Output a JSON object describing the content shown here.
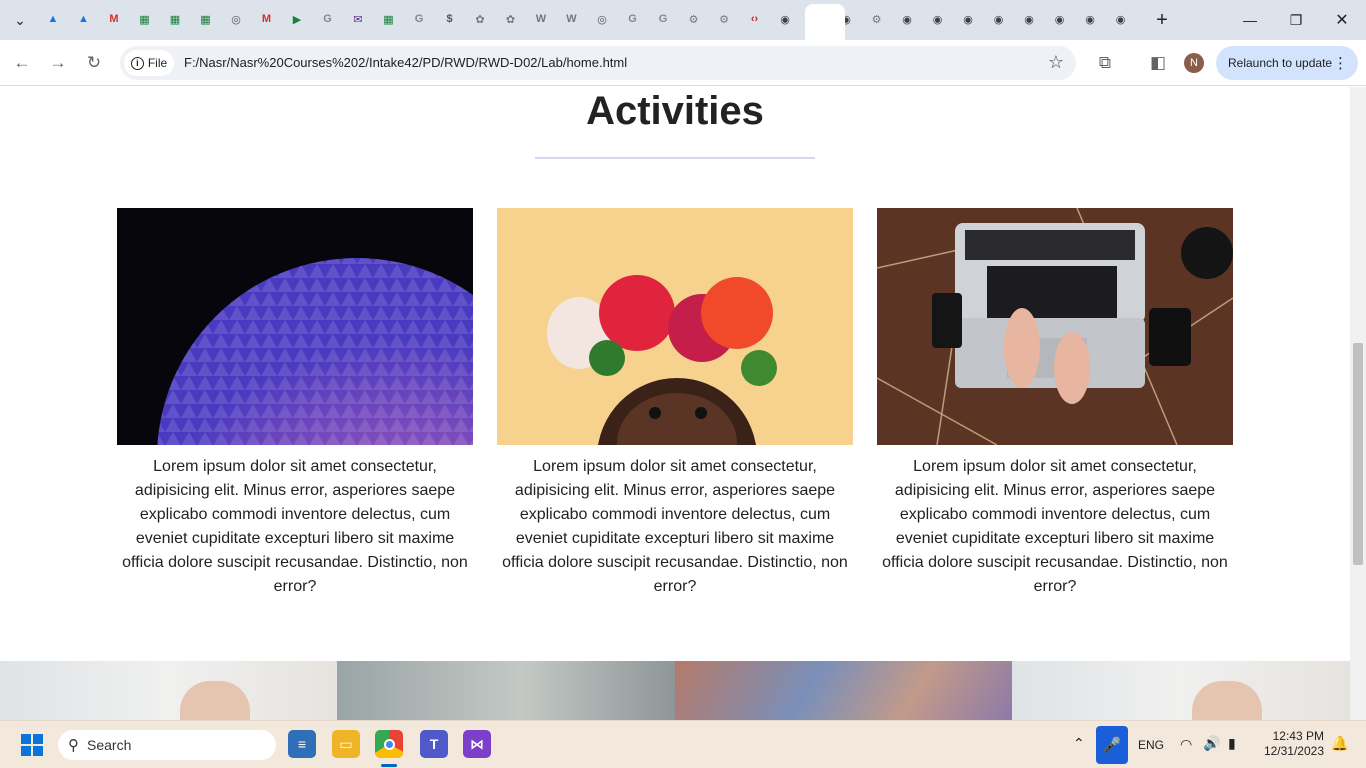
{
  "browser": {
    "tab_icons": [
      "drive-icon",
      "drive-icon",
      "gmail-icon",
      "sheets-icon",
      "sheets-icon",
      "sheets-icon",
      "tab-icon",
      "gmail-icon",
      "meet-icon",
      "google-icon",
      "mail-icon",
      "sheets-icon",
      "google-icon",
      "dollar-icon",
      "gpt-icon",
      "gpt-icon",
      "w-icon",
      "w-icon",
      "tab-icon",
      "google-icon",
      "google-icon",
      "gear-icon",
      "gear-icon",
      "code-icon",
      "chrome-icon",
      "close-icon",
      "chrome-icon",
      "gear-icon",
      "chrome-icon",
      "chrome-icon",
      "chrome-icon",
      "chrome-icon",
      "chrome-icon",
      "chrome-icon",
      "chrome-icon",
      "chrome-icon"
    ],
    "site_label": "File",
    "url": "F:/Nasr/Nasr%20Courses%202/Intake42/PD/RWD/RWD-D02/Lab/home.html",
    "relaunch_label": "Relaunch to update",
    "profile_initial": "N"
  },
  "page": {
    "heading": "Activities",
    "cards": [
      {
        "image": "dome-photo",
        "text": "Lorem ipsum dolor sit amet consectetur, adipisicing elit. Minus error, asperiores saepe explicabo commodi inventore delectus, cum eveniet cupiditate excepturi libero sit maxime officia dolore suscipit recusandae. Distinctio, non error?"
      },
      {
        "image": "flower-crown-photo",
        "text": "Lorem ipsum dolor sit amet consectetur, adipisicing elit. Minus error, asperiores saepe explicabo commodi inventore delectus, cum eveniet cupiditate excepturi libero sit maxime officia dolore suscipit recusandae. Distinctio, non error?"
      },
      {
        "image": "laptop-photo",
        "text": "Lorem ipsum dolor sit amet consectetur, adipisicing elit. Minus error, asperiores saepe explicabo commodi inventore delectus, cum eveniet cupiditate excepturi libero sit maxime officia dolore suscipit recusandae. Distinctio, non error?"
      }
    ]
  },
  "taskbar": {
    "search_label": "Search",
    "language": "ENG",
    "time": "12:43 PM",
    "date": "12/31/2023"
  },
  "colors": {
    "accent": "#1a73e8",
    "heading": "#222222",
    "underline": "#d8d4f4"
  }
}
